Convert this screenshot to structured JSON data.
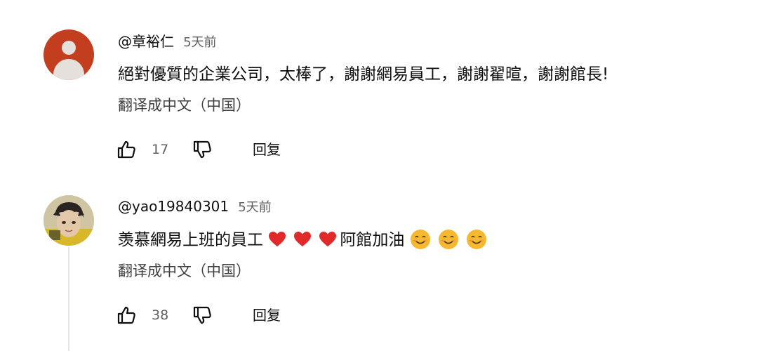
{
  "comments": [
    {
      "username": "@章裕仁",
      "time": "5天前",
      "text": "絕對優質的企業公司，太棒了，謝謝網易員工，謝謝翟暄，謝謝館長!",
      "translate_label": "翻译成中文（中国）",
      "like_count": "17",
      "reply_label": "回复",
      "avatar": "default-user-avatar",
      "avatar_color": "#c33d1f"
    },
    {
      "username": "@yao19840301",
      "time": "5天前",
      "text_before_hearts": "羡慕網易上班的員工",
      "text_between": "阿館加油",
      "heart_count": 3,
      "smile_count": 3,
      "translate_label": "翻译成中文（中国）",
      "like_count": "38",
      "reply_label": "回复",
      "avatar": "photo-avatar"
    }
  ],
  "icons": {
    "like": "thumbs-up-icon",
    "dislike": "thumbs-down-icon",
    "heart": "red-heart-emoji",
    "smile": "smiling-face-emoji"
  },
  "colors": {
    "heart": "#e0292b",
    "smile": "#f5b82e",
    "meta": "#606060"
  }
}
